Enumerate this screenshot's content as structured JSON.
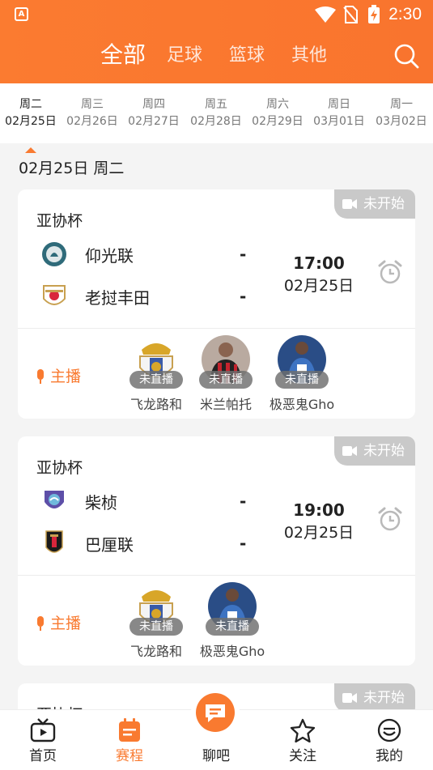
{
  "status_bar": {
    "time": "2:30",
    "app_icon_letter": "A"
  },
  "top_tabs": [
    {
      "label": "全部",
      "active": true
    },
    {
      "label": "足球",
      "active": false
    },
    {
      "label": "篮球",
      "active": false
    },
    {
      "label": "其他",
      "active": false
    }
  ],
  "days": [
    {
      "weekday": "周二",
      "date": "02月25日",
      "active": true
    },
    {
      "weekday": "周三",
      "date": "02月26日",
      "active": false
    },
    {
      "weekday": "周四",
      "date": "02月27日",
      "active": false
    },
    {
      "weekday": "周五",
      "date": "02月28日",
      "active": false
    },
    {
      "weekday": "周六",
      "date": "02月29日",
      "active": false
    },
    {
      "weekday": "周日",
      "date": "03月01日",
      "active": false
    },
    {
      "weekday": "周一",
      "date": "03月02日",
      "active": false
    }
  ],
  "section_title": "02月25日  周二",
  "matches": [
    {
      "league": "亚协杯",
      "status": "未开始",
      "home": "仰光联",
      "away": "老挝丰田",
      "home_score": "-",
      "away_score": "-",
      "time": "17:00",
      "date": "02月25日",
      "anchor_label": "主播",
      "streamers": [
        {
          "name": "飞龙路和",
          "tag": "未直播"
        },
        {
          "name": "米兰帕托",
          "tag": "未直播"
        },
        {
          "name": "极恶鬼Gho",
          "tag": "未直播"
        }
      ]
    },
    {
      "league": "亚协杯",
      "status": "未开始",
      "home": "柴桢",
      "away": "巴厘联",
      "home_score": "-",
      "away_score": "-",
      "time": "19:00",
      "date": "02月25日",
      "anchor_label": "主播",
      "streamers": [
        {
          "name": "飞龙路和",
          "tag": "未直播"
        },
        {
          "name": "极恶鬼Gho",
          "tag": "未直播"
        }
      ]
    },
    {
      "league": "亚协杯",
      "status": "未开始"
    }
  ],
  "bottom_nav": [
    {
      "label": "首页",
      "icon": "tv-icon",
      "active": false
    },
    {
      "label": "赛程",
      "icon": "schedule-icon",
      "active": true
    },
    {
      "label": "聊吧",
      "icon": "chat-icon",
      "active": false
    },
    {
      "label": "关注",
      "icon": "star-icon",
      "active": false
    },
    {
      "label": "我的",
      "icon": "profile-icon",
      "active": false
    }
  ],
  "colors": {
    "accent": "#f97a30",
    "badge": "#c9c9c9"
  }
}
